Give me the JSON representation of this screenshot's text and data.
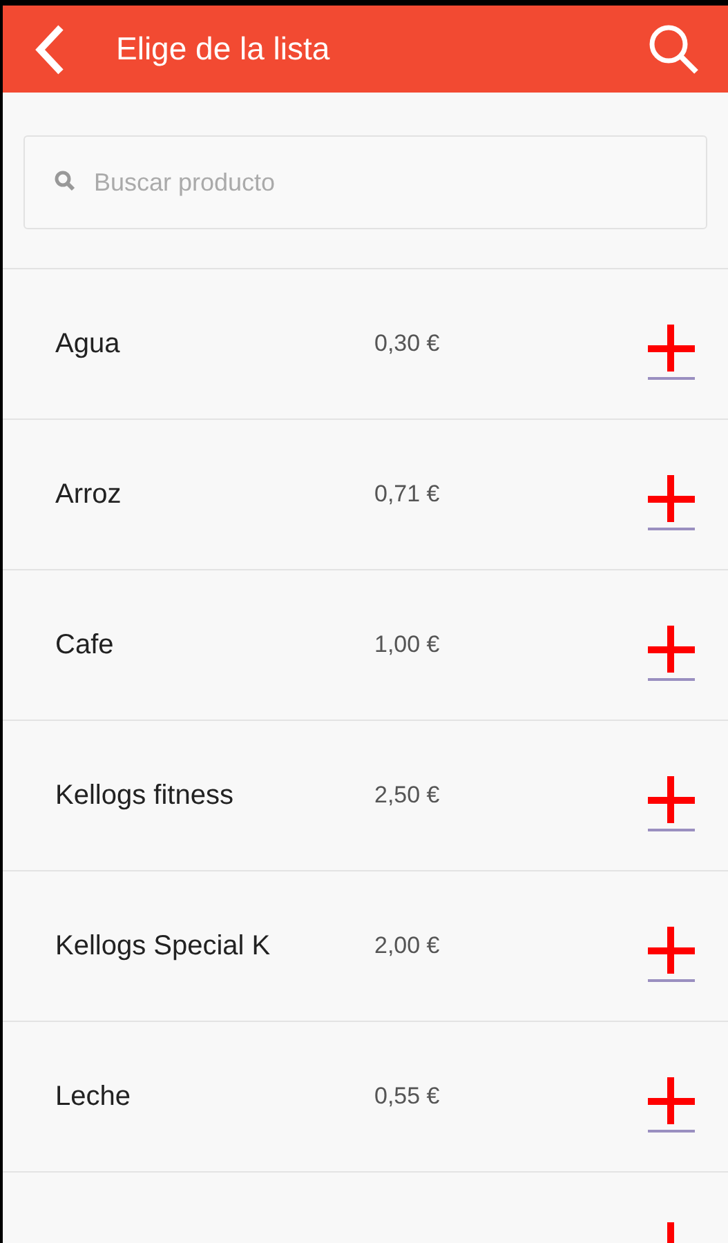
{
  "header": {
    "title": "Elige de la lista"
  },
  "search": {
    "placeholder": "Buscar producto"
  },
  "products": [
    {
      "name": "Agua",
      "price": "0,30 €"
    },
    {
      "name": "Arroz",
      "price": "0,71 €"
    },
    {
      "name": "Cafe",
      "price": "1,00 €"
    },
    {
      "name": "Kellogs fitness",
      "price": "2,50 €"
    },
    {
      "name": "Kellogs Special K",
      "price": "2,00 €"
    },
    {
      "name": "Leche",
      "price": "0,55 €"
    }
  ]
}
